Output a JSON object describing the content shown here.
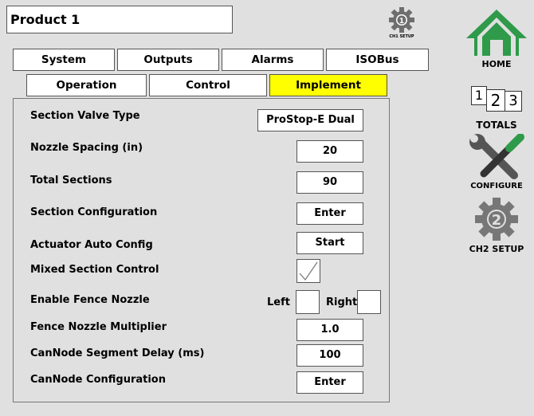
{
  "header": {
    "product_title": "Product 1",
    "ch1_setup_label": "CH1 SETUP"
  },
  "tabs": [
    {
      "label": "System"
    },
    {
      "label": "Outputs"
    },
    {
      "label": "Alarms"
    },
    {
      "label": "ISOBus"
    }
  ],
  "subtabs": [
    {
      "label": "Operation"
    },
    {
      "label": "Control"
    },
    {
      "label": "Implement",
      "active": true
    }
  ],
  "settings": {
    "section_valve_type": {
      "label": "Section Valve Type",
      "value": "ProStop-E Dual"
    },
    "nozzle_spacing": {
      "label": "Nozzle Spacing (in)",
      "value": "20"
    },
    "total_sections": {
      "label": "Total Sections",
      "value": "90"
    },
    "section_configuration": {
      "label": "Section Configuration",
      "value": "Enter"
    },
    "actuator_auto_config": {
      "label": "Actuator Auto Config",
      "value": "Start"
    },
    "mixed_section_control": {
      "label": "Mixed Section Control",
      "checked": true
    },
    "enable_fence_nozzle": {
      "label": "Enable Fence Nozzle",
      "left_label": "Left",
      "right_label": "Right",
      "left_checked": false,
      "right_checked": false
    },
    "fence_nozzle_multiplier": {
      "label": "Fence Nozzle Multiplier",
      "value": "1.0"
    },
    "cannode_segment_delay": {
      "label": "CanNode Segment Delay (ms)",
      "value": "100"
    },
    "cannode_configuration": {
      "label": "CanNode Configuration",
      "value": "Enter"
    }
  },
  "sidebar": {
    "home": {
      "label": "HOME",
      "icon": "home-icon"
    },
    "totals": {
      "label": "TOTALS",
      "icon": "totals-123-icon",
      "digits": [
        "1",
        "2",
        "3"
      ]
    },
    "configure": {
      "label": "CONFIGURE",
      "icon": "wrench-screwdriver-icon"
    },
    "ch2_setup": {
      "label": "CH2 SETUP",
      "icon": "gear-2-icon",
      "digit": "2"
    },
    "ch1_digit": "1"
  },
  "colors": {
    "background": "#e0e0e0",
    "active_tab": "#ffff00",
    "home_green": "#2e9a4a",
    "gear_gray": "#6e6e6e"
  }
}
